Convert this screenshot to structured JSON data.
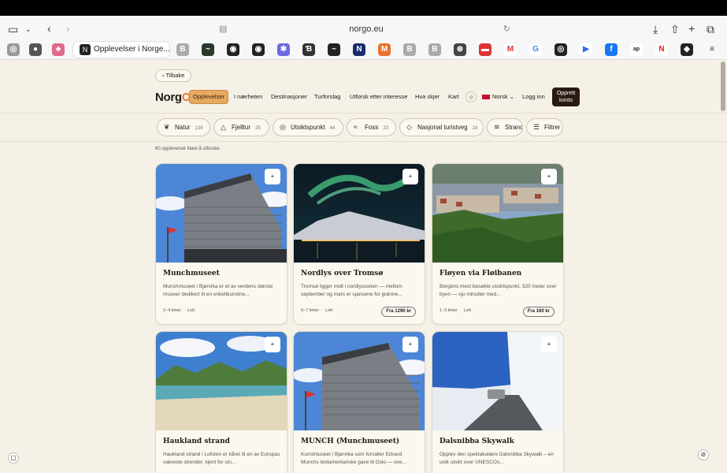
{
  "browser": {
    "url": "norgo.eu",
    "active_tab": "Opplevelser i Norge..."
  },
  "page": {
    "back_label": "Tilbake",
    "logo_text": "Norg",
    "logo_o": "O",
    "nav": [
      "Opplevelser",
      "I nærheten",
      "Destinasjoner",
      "Turforslag",
      "Utforsk etter interesse",
      "Hva skjer",
      "Kart"
    ],
    "language": "Norsk",
    "login": "Logg inn",
    "signup_line1": "Opprett",
    "signup_line2": "konto",
    "filters": [
      {
        "label": "Natur",
        "count": "139"
      },
      {
        "label": "Fjelltur",
        "count": "29"
      },
      {
        "label": "Utsiktspunkt",
        "count": "44"
      },
      {
        "label": "Foss",
        "count": "23"
      },
      {
        "label": "Nasjonal turistveg",
        "count": "18"
      },
      {
        "label": "Strand",
        "count": ""
      }
    ],
    "filter_button": "Filtrer",
    "result_count": "60 opplevelser klare å utforske",
    "cards": [
      {
        "title": "Munchmuseet",
        "desc": "Munchmuseet i Bjørvika er et av verdens største museer dedikert til en enkeltkunstne...",
        "duration": "2–4 timer",
        "level": "Lett",
        "price": ""
      },
      {
        "title": "Nordlys over Tromsø",
        "desc": "Tromsø ligger midt i nordlyssonen — mellom september og mars er sjansene for grønne...",
        "duration": "5–7 timer",
        "level": "Lett",
        "price": "Fra 1290 kr"
      },
      {
        "title": "Fløyen via Fløibanen",
        "desc": "Bergens mest besøkte utsiktspunkt, 320 meter over byen — sju minutter med...",
        "duration": "1–3 timer",
        "level": "Lett",
        "price": "Fra 160 kr"
      },
      {
        "title": "Haukland strand",
        "desc": "Haukland strand i Lofoten er kåret til en av Europas vakreste strender, kjent for sin...",
        "duration": "",
        "level": "",
        "price": ""
      },
      {
        "title": "MUNCH (Munchmuseet)",
        "desc": "Kunstmuseet i Bjørvika som forvalter Edvard Munchs testamentariske gave til Oslo — ove...",
        "duration": "",
        "level": "",
        "price": ""
      },
      {
        "title": "Dalsnibba Skywalk",
        "desc": "Opplev den spektakulære Dalsnibba Skywalk – en unik utsikt over UNESCOs...",
        "duration": "",
        "level": "",
        "price": ""
      }
    ],
    "plus": "+",
    "sep": "·"
  }
}
